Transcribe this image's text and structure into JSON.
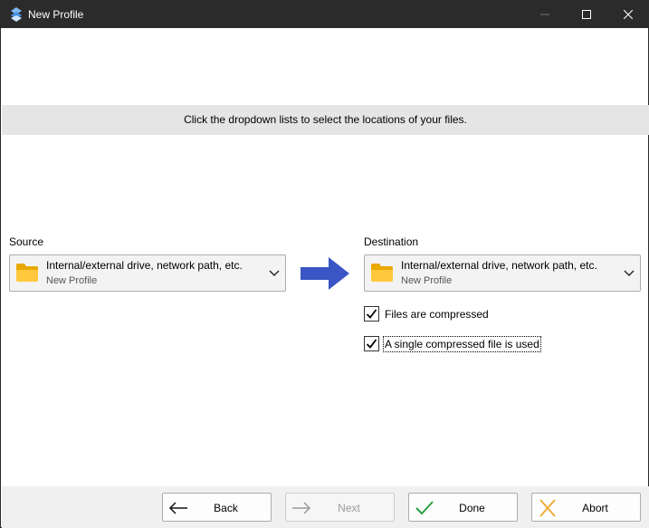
{
  "window": {
    "title": "New Profile",
    "app_icon": "app-logo-icon",
    "controls": [
      "minimize-icon",
      "maximize-icon",
      "close-icon"
    ]
  },
  "banner": {
    "text": "Click the dropdown lists to select the locations of your files."
  },
  "source": {
    "label": "Source",
    "combo": {
      "title": "Internal/external drive, network path, etc.",
      "subtitle": "New Profile",
      "icon": "folder-icon"
    }
  },
  "destination": {
    "label": "Destination",
    "combo": {
      "title": "Internal/external drive, network path, etc.",
      "subtitle": "New Profile",
      "icon": "folder-icon"
    },
    "options": [
      {
        "label": "Files are compressed",
        "checked": true
      },
      {
        "label": "A single compressed file is used",
        "checked": true
      }
    ]
  },
  "buttons": {
    "back": {
      "label": "Back",
      "icon": "arrow-left-icon",
      "enabled": true
    },
    "next": {
      "label": "Next",
      "icon": "arrow-right-icon",
      "enabled": false
    },
    "done": {
      "label": "Done",
      "icon": "checkmark-icon",
      "enabled": true
    },
    "abort": {
      "label": "Abort",
      "icon": "x-icon",
      "enabled": true
    }
  },
  "colors": {
    "titlebar": "#2b2b2b",
    "banner": "#e5e5e5",
    "arrow": "#3a55c4",
    "folder": "#f5b800",
    "done_check": "#2ea043",
    "abort_x": "#f0a830"
  }
}
